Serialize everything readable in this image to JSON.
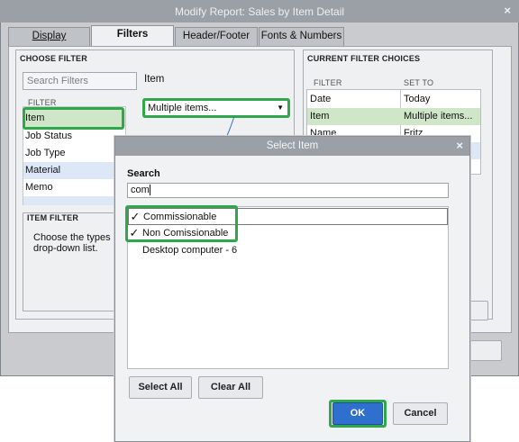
{
  "window": {
    "title": "Modify Report: Sales by Item Detail",
    "close_glyph": "×"
  },
  "tabs": [
    {
      "label": "Display"
    },
    {
      "label": "Filters"
    },
    {
      "label": "Header/Footer"
    },
    {
      "label": "Fonts & Numbers"
    }
  ],
  "choose_filter": {
    "heading": "CHOOSE FILTER",
    "search_placeholder": "Search Filters",
    "filter_col_header": "FILTER",
    "items": [
      "Item",
      "Job Status",
      "Job Type",
      "Material",
      "Memo"
    ],
    "selected_filter_label": "Item",
    "selected_value": "Multiple items...",
    "item_filter_heading": "ITEM FILTER",
    "item_filter_text": "Choose the types of",
    "item_filter_text2": "drop-down list."
  },
  "current_filters": {
    "heading": "CURRENT FILTER CHOICES",
    "col_filter": "FILTER",
    "col_set_to": "SET TO",
    "rows": [
      {
        "filter": "Date",
        "set_to": "Today"
      },
      {
        "filter": "Item",
        "set_to": "Multiple items..."
      },
      {
        "filter": "Name",
        "set_to": "Fritz"
      }
    ]
  },
  "select_item": {
    "title": "Select Item",
    "close_glyph": "×",
    "search_label": "Search",
    "search_value": "com",
    "items": [
      {
        "label": "Commissionable",
        "checked": true,
        "mark": "✓"
      },
      {
        "label": "Non Comissionable",
        "checked": true,
        "mark": "✓"
      },
      {
        "label": "Desktop computer - 6",
        "checked": false,
        "mark": ""
      }
    ],
    "select_all": "Select All",
    "clear_all": "Clear All",
    "ok": "OK",
    "cancel": "Cancel"
  },
  "colors": {
    "highlight_green": "#2ea84a",
    "title_bar": "#9aa0a6",
    "ok_blue": "#2f6fce",
    "row_selected": "#cfe6c8",
    "row_alt": "#dde8f7"
  }
}
